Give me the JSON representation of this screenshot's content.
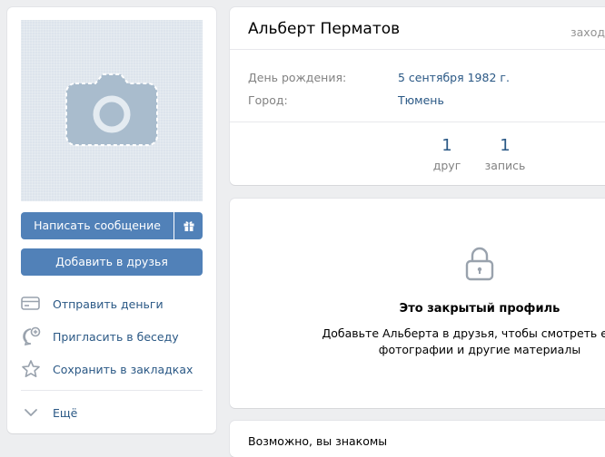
{
  "left": {
    "send_message": "Написать сообщение",
    "add_friend": "Добавить в друзья",
    "actions": [
      {
        "icon": "card-icon",
        "label": "Отправить деньги"
      },
      {
        "icon": "chat-plus-icon",
        "label": "Пригласить в беседу"
      },
      {
        "icon": "star-icon",
        "label": "Сохранить в закладках"
      }
    ],
    "more": "Ещё"
  },
  "profile": {
    "name": "Альберт Перматов",
    "online_status": "заходил",
    "birthday_label": "День рождения:",
    "birthday_value": "5 сентября 1982 г.",
    "city_label": "Город:",
    "city_value": "Тюмень",
    "counters": [
      {
        "value": "1",
        "label": "друг"
      },
      {
        "value": "1",
        "label": "запись"
      }
    ]
  },
  "closed": {
    "title": "Это закрытый профиль",
    "line1": "Добавьте Альберта в друзья, чтобы смотреть его за",
    "line2": "фотографии и другие материалы"
  },
  "suggest": {
    "title": "Возможно, вы знакомы"
  },
  "colors": {
    "accent": "#5181b8",
    "link": "#2a5885",
    "muted": "#828282",
    "background": "#edeef0"
  }
}
